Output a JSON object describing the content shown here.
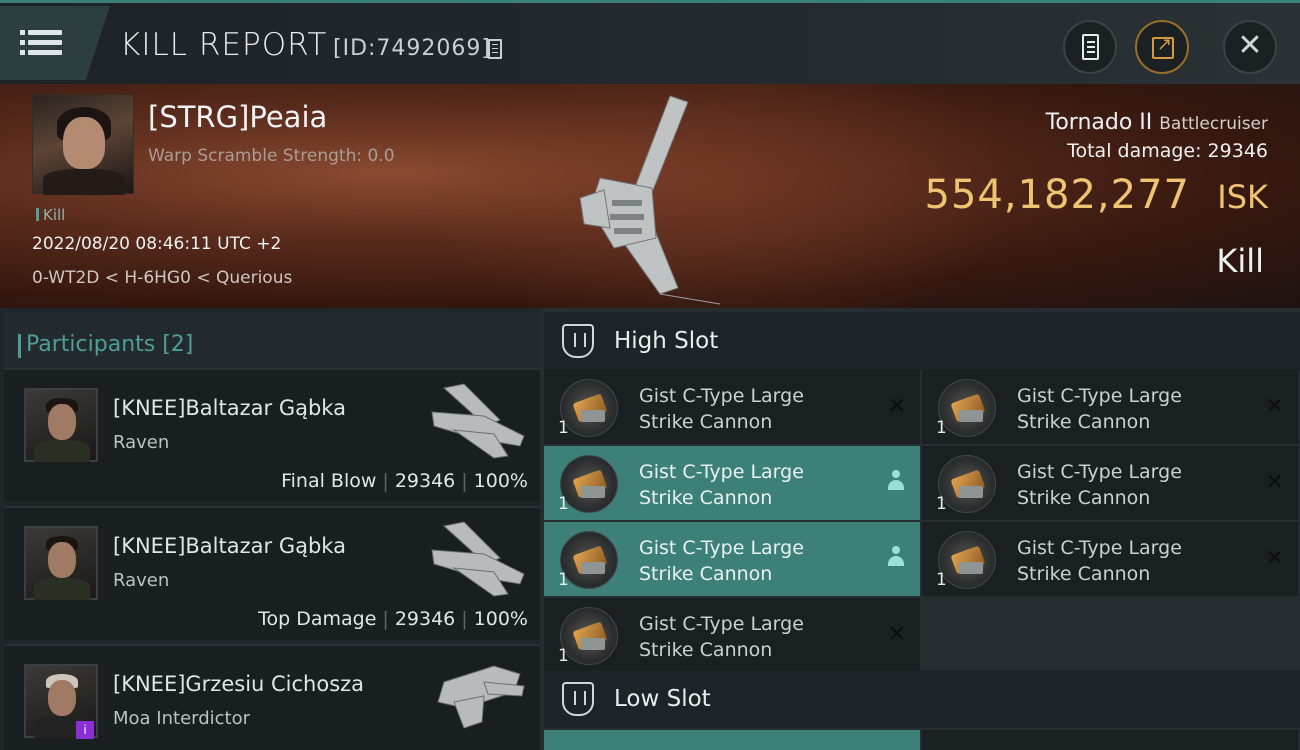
{
  "header": {
    "title": "KILL REPORT",
    "report_id": "[ID:7492069]"
  },
  "victim": {
    "name": "[STRG]Peaia",
    "warp_scramble": "Warp Scramble Strength: 0.0",
    "tag": "Kill",
    "datetime": "2022/08/20 08:46:11 UTC +2",
    "location": "0-WT2D < H-6HG0 < Querious",
    "ship": "Tornado II",
    "ship_class": "Battlecruiser",
    "total_damage": "Total damage:  29346",
    "isk_value": "554,182,277",
    "isk_unit": "ISK",
    "result": "Kill"
  },
  "participants": {
    "title": "Participants [2]",
    "rows": [
      {
        "name": "[KNEE]Baltazar Gąbka",
        "ship": "Raven",
        "role": "Final Blow",
        "damage": "29346",
        "percent": "100%"
      },
      {
        "name": "[KNEE]Baltazar Gąbka",
        "ship": "Raven",
        "role": "Top Damage",
        "damage": "29346",
        "percent": "100%"
      },
      {
        "name": "[KNEE]Grzesiu Cichosza",
        "ship": "Moa Interdictor",
        "badge": "i"
      }
    ]
  },
  "fitting": {
    "high_slot_label": "High Slot",
    "low_slot_label": "Low Slot",
    "high_modules": [
      {
        "line1": "Gist C-Type Large",
        "line2": "Strike Cannon",
        "qty": "1"
      },
      {
        "line1": "Gist C-Type Large",
        "line2": "Strike Cannon",
        "qty": "1"
      },
      {
        "line1": "Gist C-Type Large",
        "line2": "Strike Cannon",
        "qty": "1"
      },
      {
        "line1": "Gist C-Type Large",
        "line2": "Strike Cannon",
        "qty": "1"
      },
      {
        "line1": "Gist C-Type Large",
        "line2": "Strike Cannon",
        "qty": "1"
      },
      {
        "line1": "Gist C-Type Large",
        "line2": "Strike Cannon",
        "qty": "1"
      },
      {
        "line1": "Gist C-Type Large",
        "line2": "Strike Cannon",
        "qty": "1"
      }
    ]
  },
  "icons": [
    "menu-icon",
    "copy-icon",
    "report-icon",
    "share-icon",
    "close-icon",
    "shield-icon",
    "person-icon",
    "remove-icon"
  ],
  "colors": {
    "accent": "#4f9d97",
    "isk": "#f0c373",
    "active_row": "#3d8079"
  }
}
